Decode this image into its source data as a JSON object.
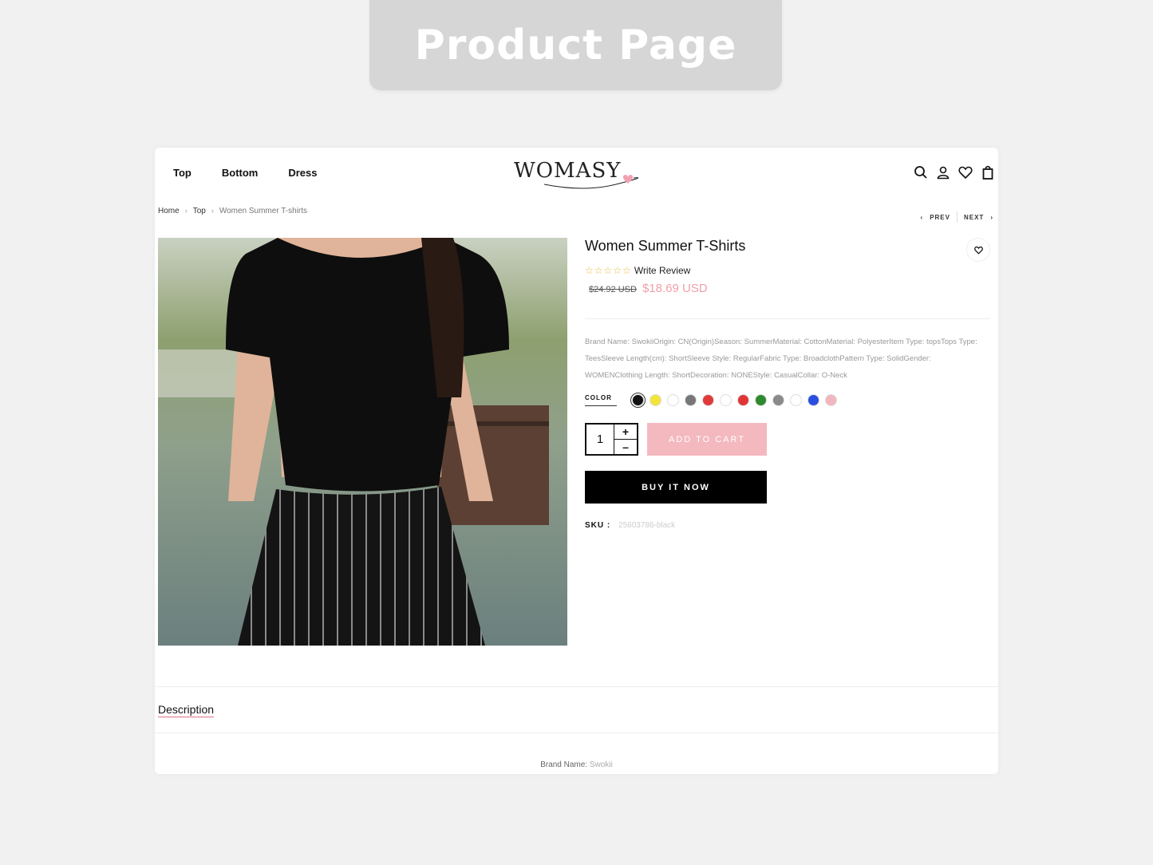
{
  "banner": {
    "title": "Product Page"
  },
  "header": {
    "nav": [
      "Top",
      "Bottom",
      "Dress"
    ],
    "logo": "WOMASY",
    "icons": [
      "search-icon",
      "user-icon",
      "heart-icon",
      "bag-icon"
    ]
  },
  "breadcrumb": {
    "home": "Home",
    "category": "Top",
    "current": "Women Summer T-shirts"
  },
  "pager": {
    "prev": "PREV",
    "next": "NEXT"
  },
  "product": {
    "title": "Women Summer T-Shirts",
    "review_label": "Write Review",
    "old_price": "$24.92 USD",
    "new_price": "$18.69 USD",
    "description": "Brand Name: SwokiiOrigin: CN(Origin)Season: SummerMaterial: CottonMaterial: PolyesterItem Type: topsTops Type: TeesSleeve Length(cm): ShortSleeve Style: RegularFabric Type: BroadclothPattern Type: SolidGender: WOMENClothing Length: ShortDecoration: NONEStyle: CasualCollar: O-Neck",
    "color_label": "COLOR",
    "colors": [
      "#111111",
      "#f2e43a",
      "#ffffff",
      "#777777",
      "#e03a3a",
      "#ffffff",
      "#e03535",
      "#2e8a2e",
      "#8a8a8a",
      "#ffffff",
      "#2a4fe0",
      "#f2b6c0"
    ],
    "quantity": "1",
    "add_to_cart": "ADD TO CART",
    "buy_now": "BUY IT NOW",
    "sku_label": "SKU :",
    "sku_value": "25603786-black"
  },
  "tabs": {
    "description": "Description"
  },
  "brand_line": {
    "label": "Brand Name:",
    "value": "Swokii"
  }
}
